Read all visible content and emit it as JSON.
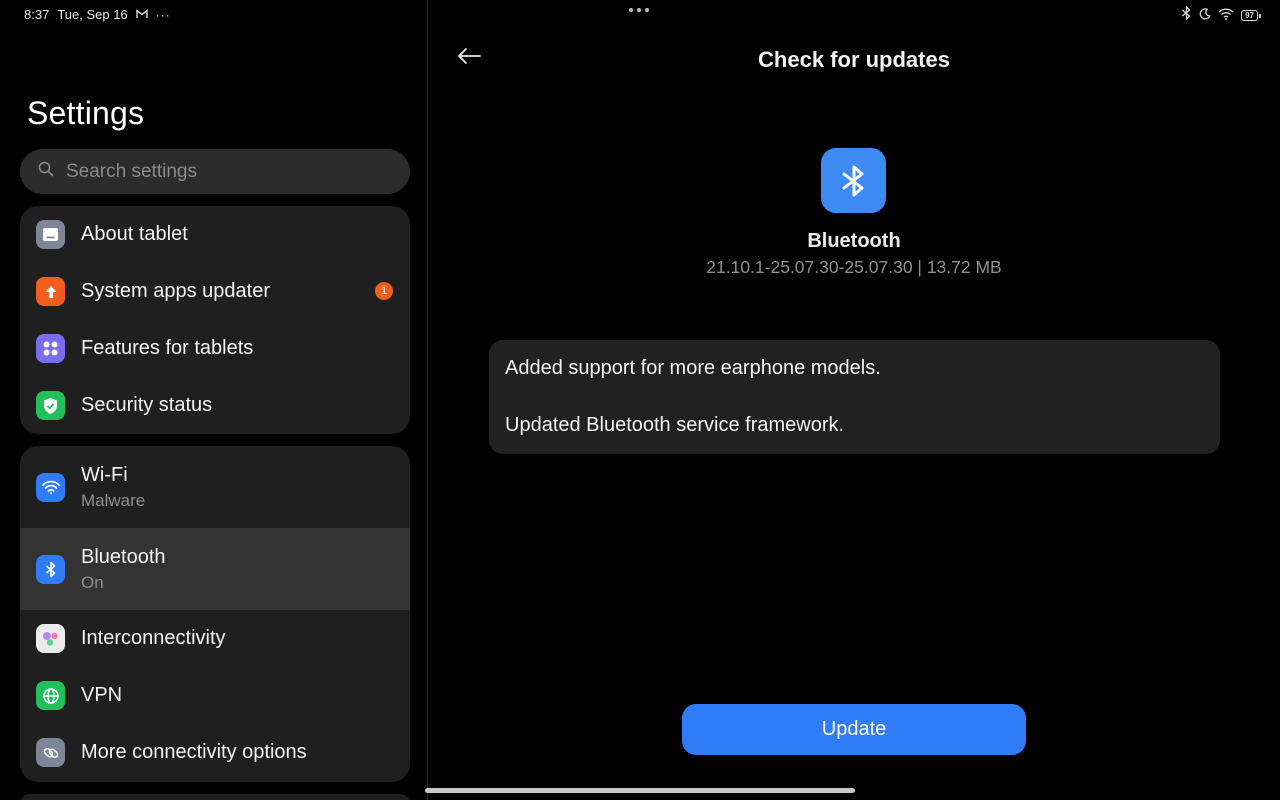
{
  "status_bar": {
    "time": "8:37",
    "date": "Tue, Sep 16",
    "battery": "97"
  },
  "sidebar": {
    "title": "Settings",
    "search": {
      "placeholder": "Search settings",
      "value": ""
    },
    "group1": [
      {
        "label": "About tablet",
        "icon": "tablet-icon",
        "color": "#7d8597"
      },
      {
        "label": "System apps updater",
        "icon": "arrow-up-icon",
        "color": "#f25c1d",
        "badge": "1"
      },
      {
        "label": "Features for tablets",
        "icon": "four-dots-icon",
        "color": "#7a6df0"
      },
      {
        "label": "Security status",
        "icon": "shield-check-icon",
        "color": "#22c05b"
      }
    ],
    "group2": [
      {
        "label": "Wi-Fi",
        "sub": "Malware",
        "icon": "wifi-icon",
        "color": "#2f7cf6"
      },
      {
        "label": "Bluetooth",
        "sub": "On",
        "icon": "bluetooth-icon",
        "color": "#2f7cf6"
      },
      {
        "label": "Interconnectivity",
        "icon": "interconnect-icon",
        "color": "#ececec"
      },
      {
        "label": "VPN",
        "icon": "globe-icon",
        "color": "#22c05b"
      },
      {
        "label": "More connectivity options",
        "icon": "link-icon",
        "color": "#7d8597"
      }
    ]
  },
  "detail": {
    "title": "Check for updates",
    "app_name": "Bluetooth",
    "version": "21.10.1-25.07.30-25.07.30 | 13.72 MB",
    "notes": [
      "Added support for more earphone models.",
      "Updated Bluetooth service framework."
    ],
    "update_label": "Update",
    "accent": "#2f7cf6"
  }
}
